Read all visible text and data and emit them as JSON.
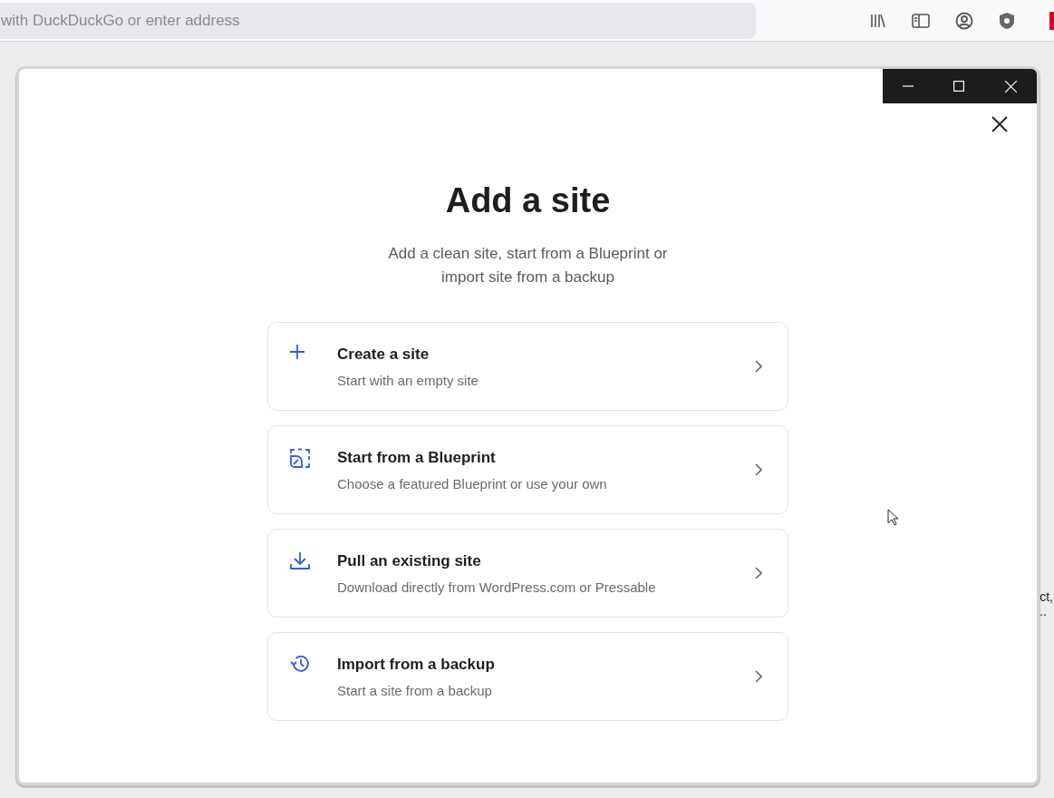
{
  "browser": {
    "address_placeholder": "with DuckDuckGo or enter address"
  },
  "background_text": [
    "ct,",
    ".."
  ],
  "dialog": {
    "title": "Add a site",
    "subtitle_lines": [
      "Add a clean site, start from a Blueprint or",
      "import site from a backup"
    ],
    "options": [
      {
        "kind": "plus",
        "title": "Create a site",
        "description": "Start with an empty site"
      },
      {
        "kind": "blueprint",
        "title": "Start from a Blueprint",
        "description": "Choose a featured Blueprint or use your own"
      },
      {
        "kind": "download",
        "title": "Pull an existing site",
        "description": "Download directly from WordPress.com or Pressable"
      },
      {
        "kind": "history",
        "title": "Import from a backup",
        "description": "Start a site from a backup"
      }
    ]
  }
}
